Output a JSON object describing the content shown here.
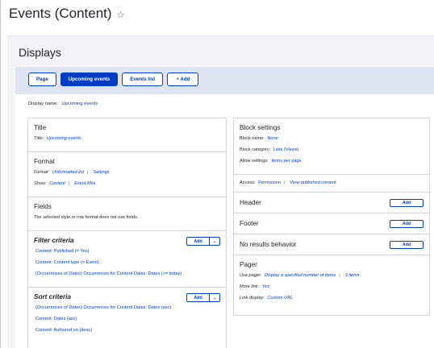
{
  "page": {
    "title": "Events (Content)",
    "star_icon": "star-icon"
  },
  "displays": {
    "heading": "Displays",
    "tabs": [
      {
        "label": "Page",
        "active": false
      },
      {
        "label": "Upcoming events",
        "active": true
      },
      {
        "label": "Events list",
        "active": false
      },
      {
        "label": "+ Add",
        "active": false
      }
    ],
    "display_name_label": "Display name:",
    "display_name_value": "Upcoming events"
  },
  "left": {
    "title": {
      "heading": "Title",
      "label": "Title:",
      "value": "Upcoming events"
    },
    "format": {
      "heading": "Format",
      "format_label": "Format:",
      "format_value": "Unformatted list",
      "format_settings": "Settings",
      "show_label": "Show:",
      "show_value": "Content",
      "show_mode": "Event Mini"
    },
    "fields": {
      "heading": "Fields",
      "note": "The selected style or row format does not use fields."
    },
    "filter": {
      "heading": "Filter criteria",
      "add": "Add",
      "items": [
        "Content: Published (= Yes)",
        "Content: Content type (= Event)",
        "(Occurrences of Dates) Occurrences for Content Dates: Dates (>= today)"
      ]
    },
    "sort": {
      "heading": "Sort criteria",
      "add": "Add",
      "items": [
        "(Occurrences of Dates) Occurrences for Content Dates: Dates (asc)",
        "Content: Dates (asc)",
        "Content: Authored on (desc)"
      ]
    }
  },
  "right": {
    "block": {
      "heading": "Block settings",
      "name_label": "Block name:",
      "name_value": "None",
      "category_label": "Block category:",
      "category_value": "Lists (Views)",
      "allow_label": "Allow settings:",
      "allow_value": "Items per page"
    },
    "access": {
      "label": "Access:",
      "value": "Permission",
      "detail": "View published content"
    },
    "header": {
      "heading": "Header",
      "add": "Add"
    },
    "footer": {
      "heading": "Footer",
      "add": "Add"
    },
    "no_results": {
      "heading": "No results behavior",
      "add": "Add"
    },
    "pager": {
      "heading": "Pager",
      "use_label": "Use pager:",
      "use_value": "Display a specified number of items",
      "use_count": "3 items",
      "more_label": "More link:",
      "more_value": "Yes",
      "link_label": "Link display:",
      "link_value": "Custom URL"
    }
  },
  "colors": {
    "accent": "#003cc5",
    "tabbar": "#dfe4f3",
    "border": "#d3d4d9"
  }
}
